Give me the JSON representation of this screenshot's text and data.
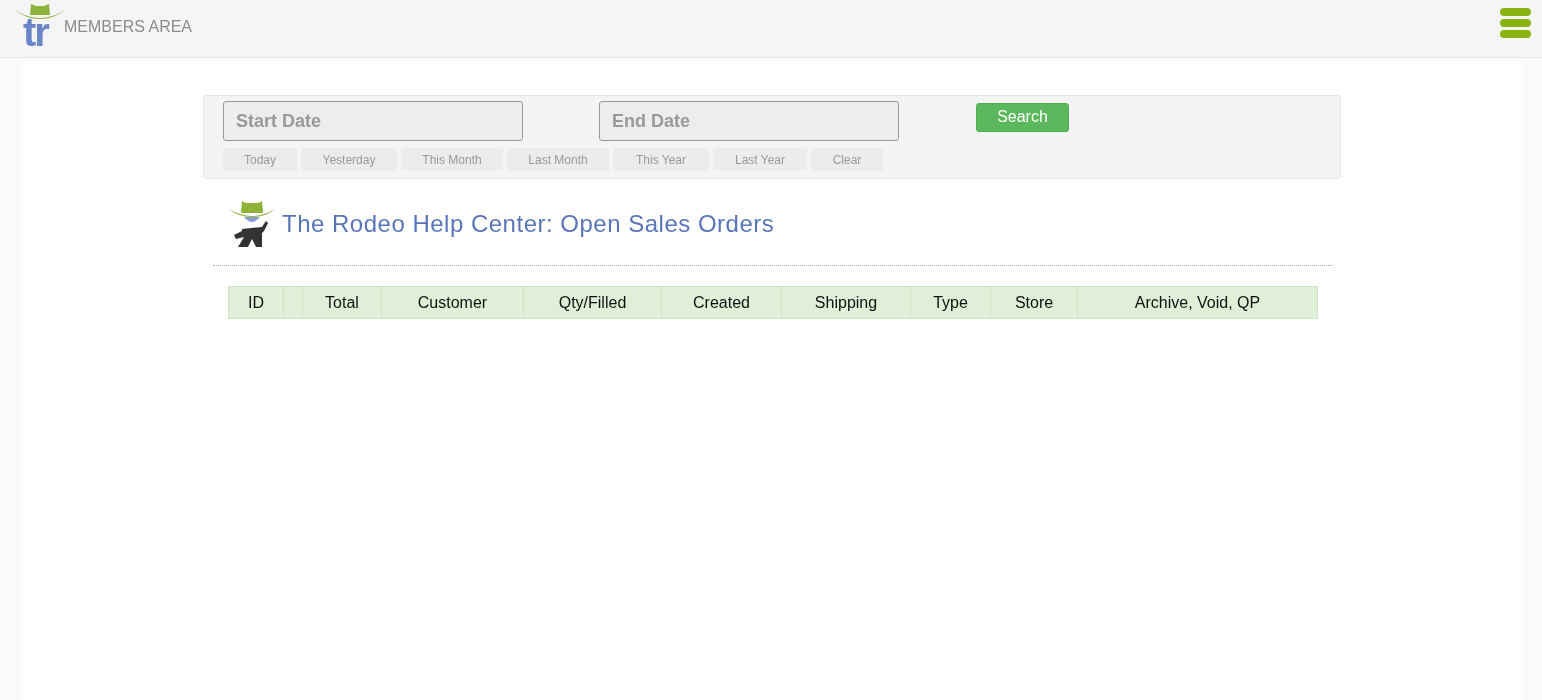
{
  "header": {
    "logo_text": "tr",
    "title": "MEMBERS AREA"
  },
  "filters": {
    "start_date": {
      "placeholder": "Start Date"
    },
    "end_date": {
      "placeholder": "End Date"
    },
    "search_button": "Search",
    "quick_ranges": [
      "Today",
      "Yesterday",
      "This Month",
      "Last Month",
      "This Year",
      "Last Year",
      "Clear"
    ]
  },
  "page_title": "The Rodeo Help Center: Open Sales Orders",
  "table": {
    "columns": [
      {
        "kind": "text",
        "label": "ID"
      },
      {
        "kind": "blank"
      },
      {
        "kind": "text",
        "label": "Total"
      },
      {
        "kind": "text",
        "label": "Customer"
      },
      {
        "kind": "text",
        "label": "Qty/Filled"
      },
      {
        "kind": "text",
        "label": "Created"
      },
      {
        "kind": "text",
        "label": "Shipping"
      },
      {
        "kind": "text",
        "label": "Type"
      },
      {
        "kind": "text",
        "label": "Store"
      },
      {
        "kind": "text",
        "label": "Archive, Void, QP"
      }
    ]
  }
}
